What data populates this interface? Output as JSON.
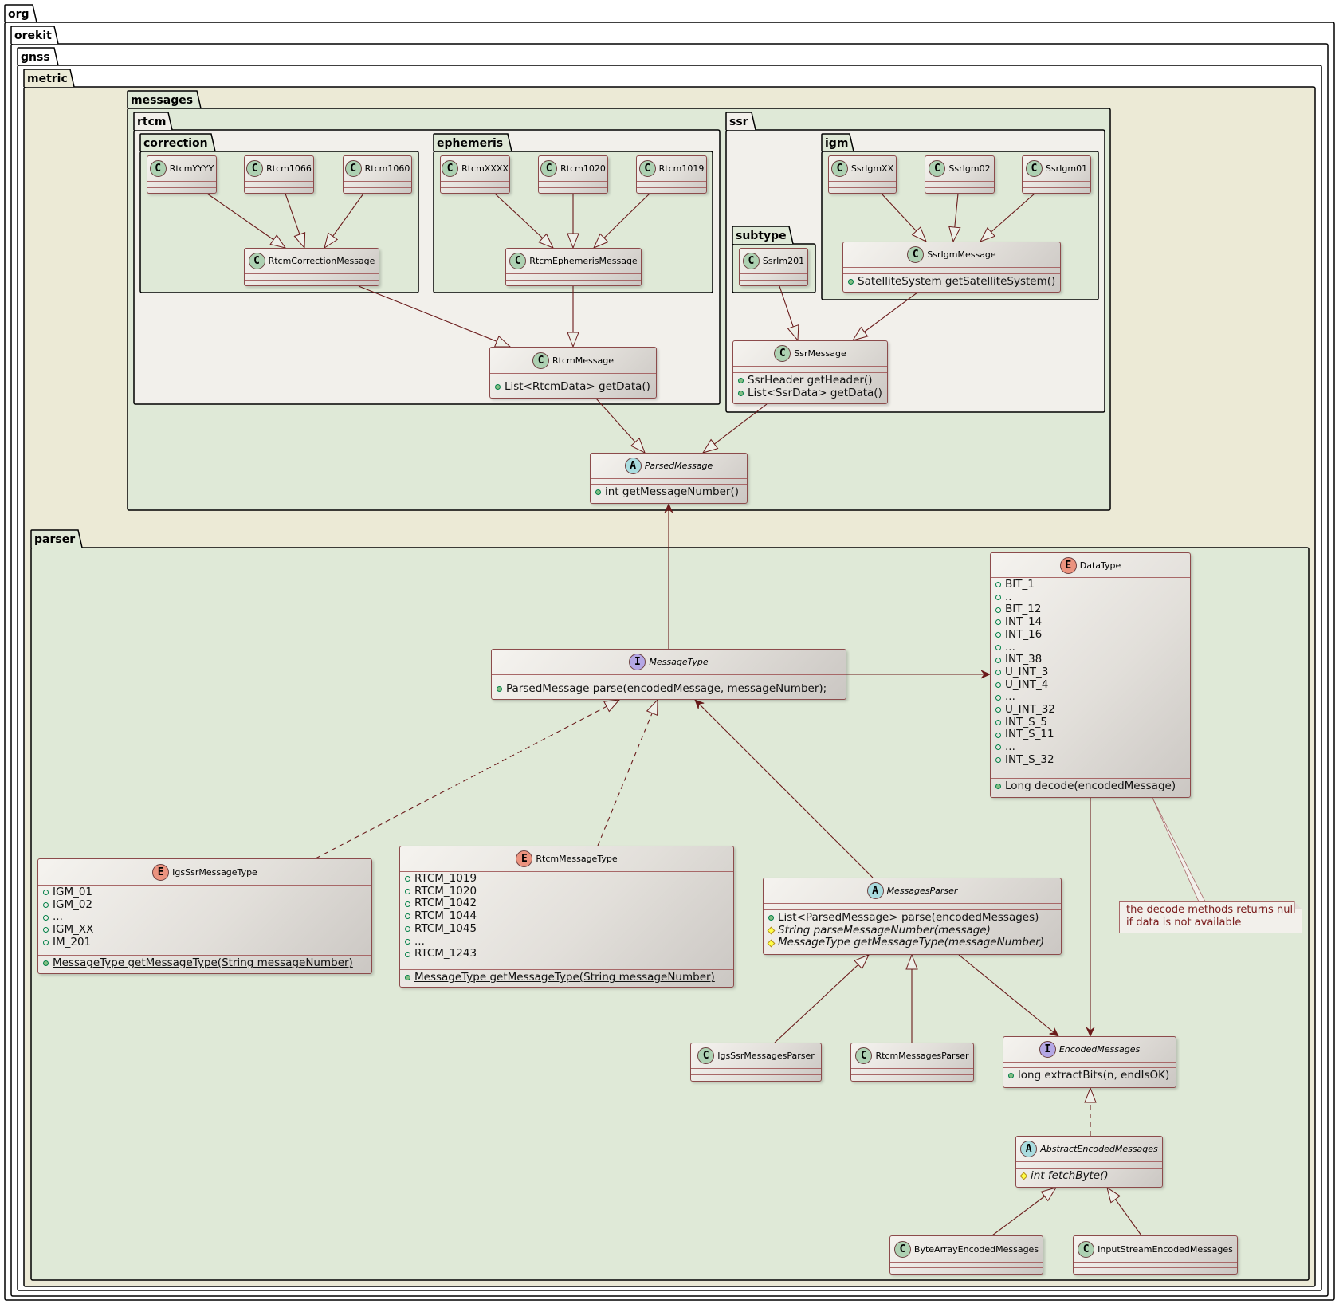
{
  "packages": [
    {
      "id": "org",
      "name": "org"
    },
    {
      "id": "orekit",
      "name": "orekit"
    },
    {
      "id": "gnss",
      "name": "gnss"
    },
    {
      "id": "metric",
      "name": "metric"
    },
    {
      "id": "messages",
      "name": "messages"
    },
    {
      "id": "rtcm",
      "name": "rtcm"
    },
    {
      "id": "correction",
      "name": "correction"
    },
    {
      "id": "ephemeris",
      "name": "ephemeris"
    },
    {
      "id": "ssr",
      "name": "ssr"
    },
    {
      "id": "igm",
      "name": "igm"
    },
    {
      "id": "subtype",
      "name": "subtype"
    },
    {
      "id": "parser",
      "name": "parser"
    }
  ],
  "classes": [
    {
      "id": "RtcmYYYY",
      "name": "RtcmYYYY",
      "kind": "C",
      "attributes": [],
      "methods": []
    },
    {
      "id": "Rtcm1066",
      "name": "Rtcm1066",
      "kind": "C",
      "attributes": [],
      "methods": []
    },
    {
      "id": "Rtcm1060",
      "name": "Rtcm1060",
      "kind": "C",
      "attributes": [],
      "methods": []
    },
    {
      "id": "RtcmXXXX",
      "name": "RtcmXXXX",
      "kind": "C",
      "attributes": [],
      "methods": []
    },
    {
      "id": "Rtcm1020",
      "name": "Rtcm1020",
      "kind": "C",
      "attributes": [],
      "methods": []
    },
    {
      "id": "Rtcm1019",
      "name": "Rtcm1019",
      "kind": "C",
      "attributes": [],
      "methods": []
    },
    {
      "id": "RtcmCorrectionMessage",
      "name": "RtcmCorrectionMessage",
      "kind": "C",
      "attributes": [],
      "methods": []
    },
    {
      "id": "RtcmEphemerisMessage",
      "name": "RtcmEphemerisMessage",
      "kind": "C",
      "attributes": [],
      "methods": []
    },
    {
      "id": "RtcmMessage",
      "name": "RtcmMessage",
      "kind": "C",
      "attributes": [],
      "methods": [
        {
          "vis": "public",
          "text": "List<RtcmData> getData()"
        }
      ]
    },
    {
      "id": "SsrIgmXX",
      "name": "SsrIgmXX",
      "kind": "C",
      "attributes": [],
      "methods": []
    },
    {
      "id": "SsrIgm02",
      "name": "SsrIgm02",
      "kind": "C",
      "attributes": [],
      "methods": []
    },
    {
      "id": "SsrIgm01",
      "name": "SsrIgm01",
      "kind": "C",
      "attributes": [],
      "methods": []
    },
    {
      "id": "SsrIgmMessage",
      "name": "SsrIgmMessage",
      "kind": "C",
      "attributes": [],
      "methods": [
        {
          "vis": "public",
          "text": "SatelliteSystem getSatelliteSystem()"
        }
      ]
    },
    {
      "id": "SsrIm201",
      "name": "SsrIm201",
      "kind": "C",
      "attributes": [],
      "methods": []
    },
    {
      "id": "SsrMessage",
      "name": "SsrMessage",
      "kind": "C",
      "attributes": [],
      "methods": [
        {
          "vis": "public",
          "text": "SsrHeader getHeader()"
        },
        {
          "vis": "public",
          "text": "List<SsrData> getData()"
        }
      ]
    },
    {
      "id": "ParsedMessage",
      "name": "ParsedMessage",
      "kind": "A",
      "attributes": [],
      "methods": [
        {
          "vis": "public",
          "text": "int getMessageNumber()"
        }
      ]
    },
    {
      "id": "MessageType",
      "name": "MessageType",
      "kind": "I",
      "attributes": [],
      "methods": [
        {
          "vis": "public",
          "text": "ParsedMessage parse(encodedMessage, messageNumber);"
        }
      ]
    },
    {
      "id": "DataType",
      "name": "DataType",
      "kind": "E",
      "attributes": [
        "BIT_1",
        "..",
        "BIT_12",
        "INT_14",
        "INT_16",
        "...",
        "INT_38",
        "U_INT_3",
        "U_INT_4",
        "...",
        "U_INT_32",
        "INT_S_5",
        "INT_S_11",
        "...",
        "INT_S_32"
      ],
      "methods": [
        {
          "vis": "public",
          "text": "Long decode(encodedMessage)"
        }
      ]
    },
    {
      "id": "IgsSsrMessageType",
      "name": "IgsSsrMessageType",
      "kind": "E",
      "attributes": [
        "IGM_01",
        "IGM_02",
        "...",
        "IGM_XX",
        "IM_201"
      ],
      "methods": [
        {
          "vis": "public",
          "text": "MessageType getMessageType(String messageNumber)",
          "static": true
        }
      ]
    },
    {
      "id": "RtcmMessageType",
      "name": "RtcmMessageType",
      "kind": "E",
      "attributes": [
        "RTCM_1019",
        "RTCM_1020",
        "RTCM_1042",
        "RTCM_1044",
        "RTCM_1045",
        "...",
        "RTCM_1243"
      ],
      "methods": [
        {
          "vis": "public",
          "text": "MessageType getMessageType(String messageNumber)",
          "static": true
        }
      ]
    },
    {
      "id": "MessagesParser",
      "name": "MessagesParser",
      "kind": "A",
      "attributes": [],
      "methods": [
        {
          "vis": "public",
          "text": "List<ParsedMessage> parse(encodedMessages)"
        },
        {
          "vis": "protected",
          "text": "String parseMessageNumber(message)",
          "italic": true
        },
        {
          "vis": "protected",
          "text": "MessageType getMessageType(messageNumber)",
          "italic": true
        }
      ]
    },
    {
      "id": "IgsSsrMessagesParser",
      "name": "IgsSsrMessagesParser",
      "kind": "C",
      "attributes": [],
      "methods": []
    },
    {
      "id": "RtcmMessagesParser",
      "name": "RtcmMessagesParser",
      "kind": "C",
      "attributes": [],
      "methods": []
    },
    {
      "id": "EncodedMessages",
      "name": "EncodedMessages",
      "kind": "I",
      "attributes": [],
      "methods": [
        {
          "vis": "public",
          "text": "long extractBits(n, endIsOK)"
        }
      ]
    },
    {
      "id": "AbstractEncodedMessages",
      "name": "AbstractEncodedMessages",
      "kind": "A",
      "attributes": [],
      "methods": [
        {
          "vis": "protected",
          "text": "int fetchByte()",
          "italic": true
        }
      ]
    },
    {
      "id": "ByteArrayEncodedMessages",
      "name": "ByteArrayEncodedMessages",
      "kind": "C",
      "attributes": [],
      "methods": []
    },
    {
      "id": "InputStreamEncodedMessages",
      "name": "InputStreamEncodedMessages",
      "kind": "C",
      "attributes": [],
      "methods": []
    }
  ],
  "relations": [
    {
      "from": "RtcmYYYY",
      "to": "RtcmCorrectionMessage",
      "type": "extends"
    },
    {
      "from": "Rtcm1066",
      "to": "RtcmCorrectionMessage",
      "type": "extends"
    },
    {
      "from": "Rtcm1060",
      "to": "RtcmCorrectionMessage",
      "type": "extends"
    },
    {
      "from": "RtcmXXXX",
      "to": "RtcmEphemerisMessage",
      "type": "extends"
    },
    {
      "from": "Rtcm1020",
      "to": "RtcmEphemerisMessage",
      "type": "extends"
    },
    {
      "from": "Rtcm1019",
      "to": "RtcmEphemerisMessage",
      "type": "extends"
    },
    {
      "from": "RtcmCorrectionMessage",
      "to": "RtcmMessage",
      "type": "extends"
    },
    {
      "from": "RtcmEphemerisMessage",
      "to": "RtcmMessage",
      "type": "extends"
    },
    {
      "from": "RtcmMessage",
      "to": "ParsedMessage",
      "type": "extends"
    },
    {
      "from": "SsrIgmXX",
      "to": "SsrIgmMessage",
      "type": "extends"
    },
    {
      "from": "SsrIgm02",
      "to": "SsrIgmMessage",
      "type": "extends"
    },
    {
      "from": "SsrIgm01",
      "to": "SsrIgmMessage",
      "type": "extends"
    },
    {
      "from": "SsrIgmMessage",
      "to": "SsrMessage",
      "type": "extends"
    },
    {
      "from": "SsrIm201",
      "to": "SsrMessage",
      "type": "extends"
    },
    {
      "from": "SsrMessage",
      "to": "ParsedMessage",
      "type": "extends"
    },
    {
      "from": "MessageType",
      "to": "ParsedMessage",
      "type": "association"
    },
    {
      "from": "MessageType",
      "to": "DataType",
      "type": "association"
    },
    {
      "from": "IgsSsrMessageType",
      "to": "MessageType",
      "type": "implements"
    },
    {
      "from": "RtcmMessageType",
      "to": "MessageType",
      "type": "implements"
    },
    {
      "from": "MessagesParser",
      "to": "MessageType",
      "type": "association"
    },
    {
      "from": "IgsSsrMessagesParser",
      "to": "MessagesParser",
      "type": "extends"
    },
    {
      "from": "RtcmMessagesParser",
      "to": "MessagesParser",
      "type": "extends"
    },
    {
      "from": "MessagesParser",
      "to": "EncodedMessages",
      "type": "association"
    },
    {
      "from": "DataType",
      "to": "EncodedMessages",
      "type": "association"
    },
    {
      "from": "AbstractEncodedMessages",
      "to": "EncodedMessages",
      "type": "implements"
    },
    {
      "from": "ByteArrayEncodedMessages",
      "to": "AbstractEncodedMessages",
      "type": "extends"
    },
    {
      "from": "InputStreamEncodedMessages",
      "to": "AbstractEncodedMessages",
      "type": "extends"
    }
  ],
  "note": {
    "attached_to": "DataType",
    "lines": [
      "the decode methods returns null",
      "if data is not available"
    ]
  },
  "colors": {
    "arrow": "#6b1b1b",
    "class_border": "#8c4b4b",
    "package_green": "#dfe9d7",
    "package_beige": "#ecead6",
    "package_light": "#f2f0eb",
    "spot_class": "#add1b2",
    "spot_abstract": "#a9dcdf",
    "spot_interface": "#b4a7e5",
    "spot_enum": "#eb937f",
    "note_text": "#7a1c1c"
  }
}
